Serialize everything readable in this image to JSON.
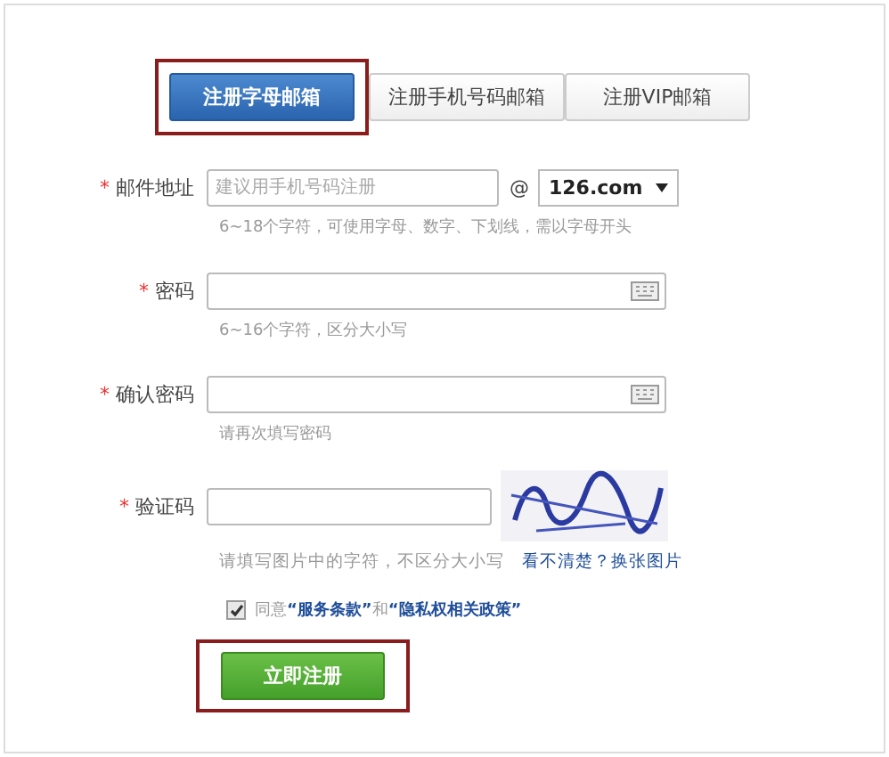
{
  "tabs": [
    {
      "label": "注册字母邮箱",
      "selected": true
    },
    {
      "label": "注册手机号码邮箱",
      "selected": false
    },
    {
      "label": "注册VIP邮箱",
      "selected": false
    }
  ],
  "email": {
    "required_mark": "*",
    "label": "邮件地址",
    "placeholder": "建议用手机号码注册",
    "at": "@",
    "domain": "126.com",
    "hint": "6~18个字符，可使用字母、数字、下划线，需以字母开头"
  },
  "password": {
    "required_mark": "*",
    "label": "密码",
    "hint": "6~16个字符，区分大小写"
  },
  "confirm_password": {
    "required_mark": "*",
    "label": "确认密码",
    "hint": "请再次填写密码"
  },
  "captcha": {
    "required_mark": "*",
    "label": "验证码",
    "hint": "请填写图片中的字符，不区分大小写",
    "refresh_link": "看不清楚？换张图片"
  },
  "agreement": {
    "checked": true,
    "prefix": "同意",
    "terms_link": "“服务条款”",
    "and": "和",
    "privacy_link": "“隐私权相关政策”"
  },
  "submit": {
    "label": "立即注册",
    "highlighted": true
  }
}
